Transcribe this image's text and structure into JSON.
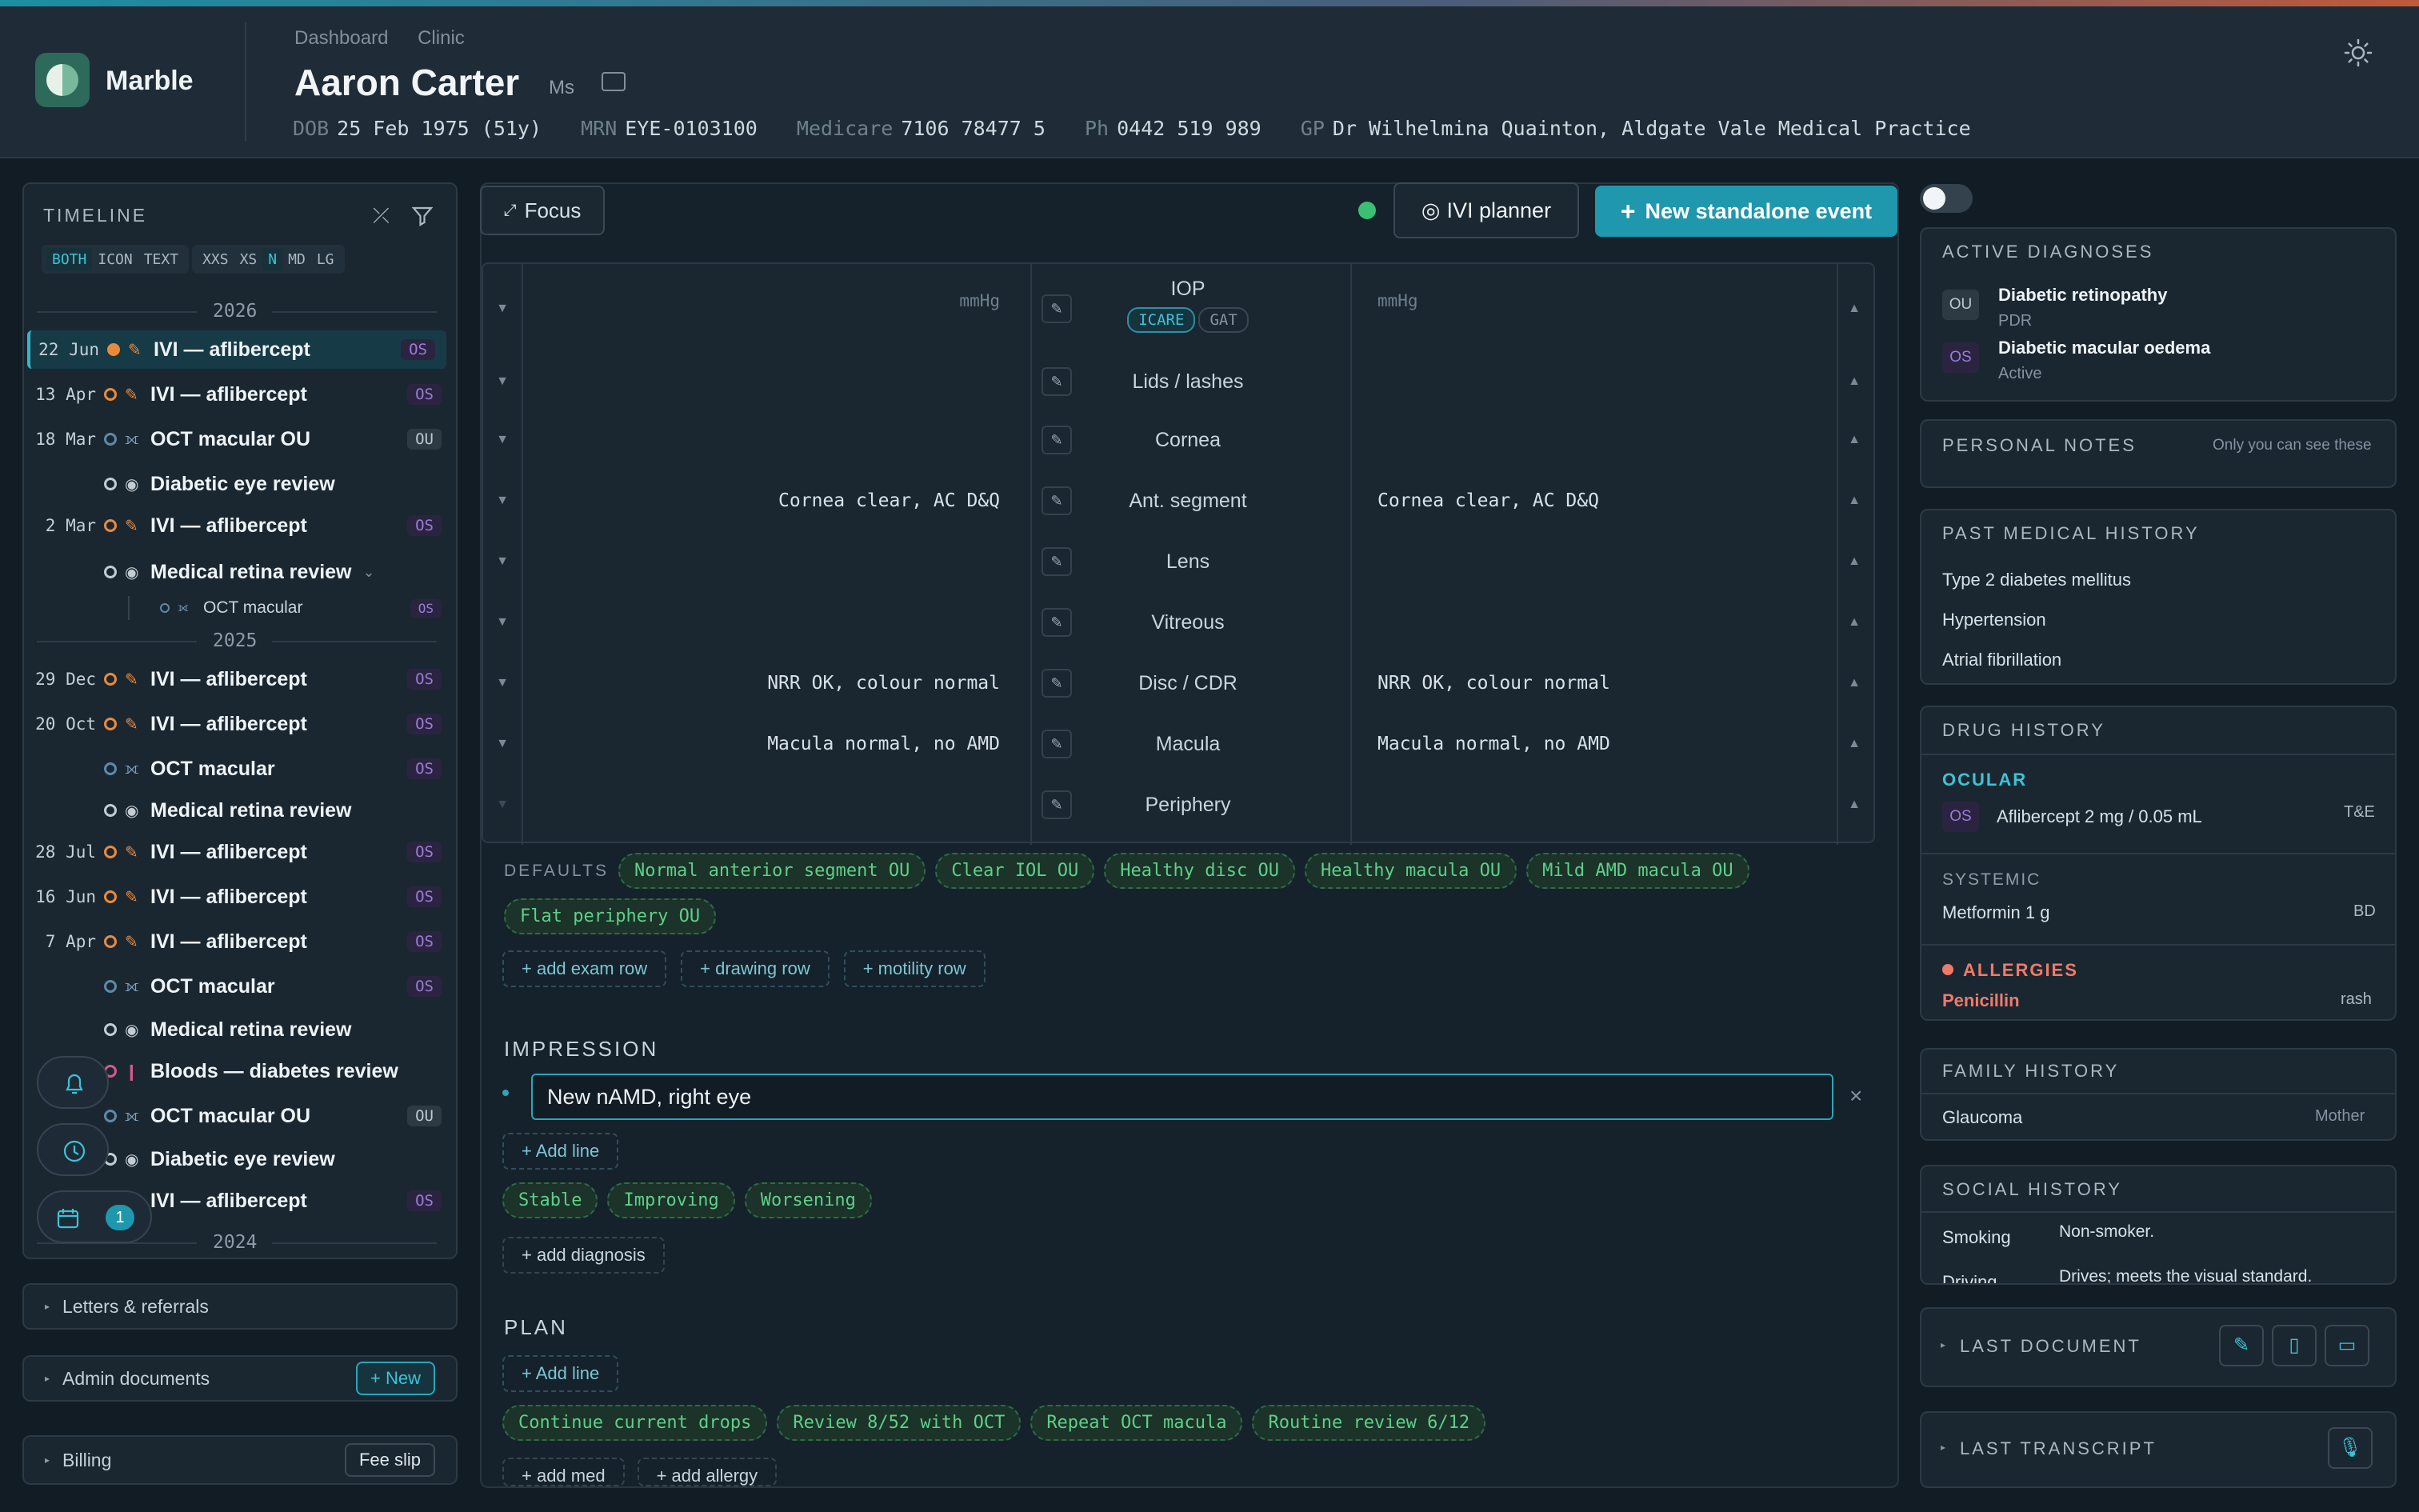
{
  "app": {
    "name": "Marble"
  },
  "breadcrumb": [
    "Dashboard",
    "Clinic"
  ],
  "patient": {
    "name": "Aaron Carter",
    "title": "Ms",
    "dob_label": "DOB",
    "dob": "25 Feb 1975 (51y)",
    "mrn_label": "MRN",
    "mrn": "EYE-0103100",
    "medicare_label": "Medicare",
    "medicare": "7106 78477 5",
    "ph_label": "Ph",
    "ph": "0442 519 989",
    "gp_label": "GP",
    "gp": "Dr Wilhelmina Quainton, Aldgate Vale Medical Practice"
  },
  "timeline": {
    "title": "TIMELINE",
    "mode": [
      "BOTH",
      "ICON",
      "TEXT"
    ],
    "size": [
      "XXS",
      "XS",
      "N",
      "MD",
      "LG"
    ],
    "years": [
      "2026",
      "2025",
      "2024"
    ],
    "events": [
      {
        "date": "22 Jun",
        "title": "IVI — aflibercept",
        "badge": "OS"
      },
      {
        "date": "13 Apr",
        "title": "IVI — aflibercept",
        "badge": "OS"
      },
      {
        "date": "18 Mar",
        "title": "OCT macular OU",
        "badge": "OU"
      },
      {
        "date": "",
        "title": "Diabetic eye review",
        "badge": ""
      },
      {
        "date": "2 Mar",
        "title": "IVI — aflibercept",
        "badge": "OS"
      },
      {
        "date": "",
        "title": "Medical retina review",
        "badge": ""
      },
      {
        "date": "",
        "title": "OCT macular",
        "badge": "OS"
      },
      {
        "date": "29 Dec",
        "title": "IVI — aflibercept",
        "badge": "OS"
      },
      {
        "date": "20 Oct",
        "title": "IVI — aflibercept",
        "badge": "OS"
      },
      {
        "date": "",
        "title": "OCT macular",
        "badge": "OS"
      },
      {
        "date": "",
        "title": "Medical retina review",
        "badge": ""
      },
      {
        "date": "28 Jul",
        "title": "IVI — aflibercept",
        "badge": "OS"
      },
      {
        "date": "16 Jun",
        "title": "IVI — aflibercept",
        "badge": "OS"
      },
      {
        "date": "7 Apr",
        "title": "IVI — aflibercept",
        "badge": "OS"
      },
      {
        "date": "",
        "title": "OCT macular",
        "badge": "OS"
      },
      {
        "date": "",
        "title": "Medical retina review",
        "badge": ""
      },
      {
        "date": "",
        "title": "Bloods — diabetes review",
        "badge": ""
      },
      {
        "date": "",
        "title": "OCT macular OU",
        "badge": "OU"
      },
      {
        "date": "",
        "title": "Diabetic eye review",
        "badge": ""
      },
      {
        "date": "",
        "title": "IVI — aflibercept",
        "badge": "OS"
      }
    ],
    "calendar_count": "1"
  },
  "left_sections": {
    "letters": "Letters & referrals",
    "admin": "Admin documents",
    "admin_btn": "+ New",
    "billing": "Billing",
    "billing_btn": "Fee slip"
  },
  "toolbar": {
    "focus": "Focus",
    "ivi_planner": "IVI planner",
    "new_event": "New standalone event"
  },
  "exam": {
    "rows": [
      {
        "label": "IOP",
        "left": "mmHg",
        "right": "mmHg"
      },
      {
        "label": "Lids / lashes",
        "left": "",
        "right": ""
      },
      {
        "label": "Cornea",
        "left": "",
        "right": ""
      },
      {
        "label": "Ant. segment",
        "left": "Cornea clear, AC D&Q",
        "right": "Cornea clear, AC D&Q"
      },
      {
        "label": "Lens",
        "left": "",
        "right": ""
      },
      {
        "label": "Vitreous",
        "left": "",
        "right": ""
      },
      {
        "label": "Disc / CDR",
        "left": "NRR OK, colour normal",
        "right": "NRR OK, colour normal"
      },
      {
        "label": "Macula",
        "left": "Macula normal, no AMD",
        "right": "Macula normal, no AMD"
      },
      {
        "label": "Periphery",
        "left": "",
        "right": ""
      }
    ],
    "iop_methods": [
      "ICARE",
      "GAT"
    ]
  },
  "defaults": {
    "label": "DEFAULTS",
    "chips": [
      "Normal anterior segment OU",
      "Clear IOL OU",
      "Healthy disc OU",
      "Healthy macula OU",
      "Mild AMD macula OU",
      "Flat periphery OU"
    ],
    "add_buttons": [
      "+ add exam row",
      "+ drawing row",
      "+ motility row"
    ]
  },
  "impression": {
    "title": "IMPRESSION",
    "value": "New nAMD, right eye",
    "add_line": "+ Add line",
    "chips": [
      "Stable",
      "Improving",
      "Worsening"
    ],
    "add_diagnosis": "+ add diagnosis"
  },
  "plan": {
    "title": "PLAN",
    "add_line": "+ Add line",
    "chips": [
      "Continue current drops",
      "Review 8/52 with OCT",
      "Repeat OCT macula",
      "Routine review 6/12"
    ],
    "add_med": "+ add med",
    "add_allergy": "+ add allergy"
  },
  "right": {
    "active_dx": {
      "title": "ACTIVE DIAGNOSES",
      "items": [
        {
          "eye": "OU",
          "name": "Diabetic retinopathy",
          "sub": "PDR"
        },
        {
          "eye": "OS",
          "name": "Diabetic macular oedema",
          "sub": "Active"
        }
      ]
    },
    "notes": {
      "title": "PERSONAL NOTES",
      "hint": "Only you can see these"
    },
    "pmh": {
      "title": "PAST MEDICAL HISTORY",
      "items": [
        "Type 2 diabetes mellitus",
        "Hypertension",
        "Atrial fibrillation"
      ]
    },
    "drug": {
      "title": "DRUG HISTORY",
      "ocular_label": "OCULAR",
      "ocular": {
        "eye": "OS",
        "name": "Aflibercept 2 mg / 0.05 mL",
        "freq": "T&E"
      },
      "systemic_label": "SYSTEMIC",
      "systemic": {
        "name": "Metformin 1 g",
        "freq": "BD"
      },
      "allergy_label": "ALLERGIES",
      "allergy": {
        "name": "Penicillin",
        "reaction": "rash"
      }
    },
    "family": {
      "title": "FAMILY HISTORY",
      "item": "Glaucoma",
      "relation": "Mother"
    },
    "social": {
      "title": "SOCIAL HISTORY",
      "items": [
        {
          "k": "Smoking",
          "v": "Non-smoker."
        },
        {
          "k": "Driving",
          "v": "Drives; meets the visual standard."
        }
      ]
    },
    "last_document": "LAST DOCUMENT",
    "last_transcript": "LAST TRANSCRIPT"
  },
  "colors": {
    "accent": "#1f97ad",
    "orange": "#e98a3b",
    "purple": "#9c7bd8",
    "green": "#5fcf8a",
    "allergy": "#f07a6a"
  }
}
